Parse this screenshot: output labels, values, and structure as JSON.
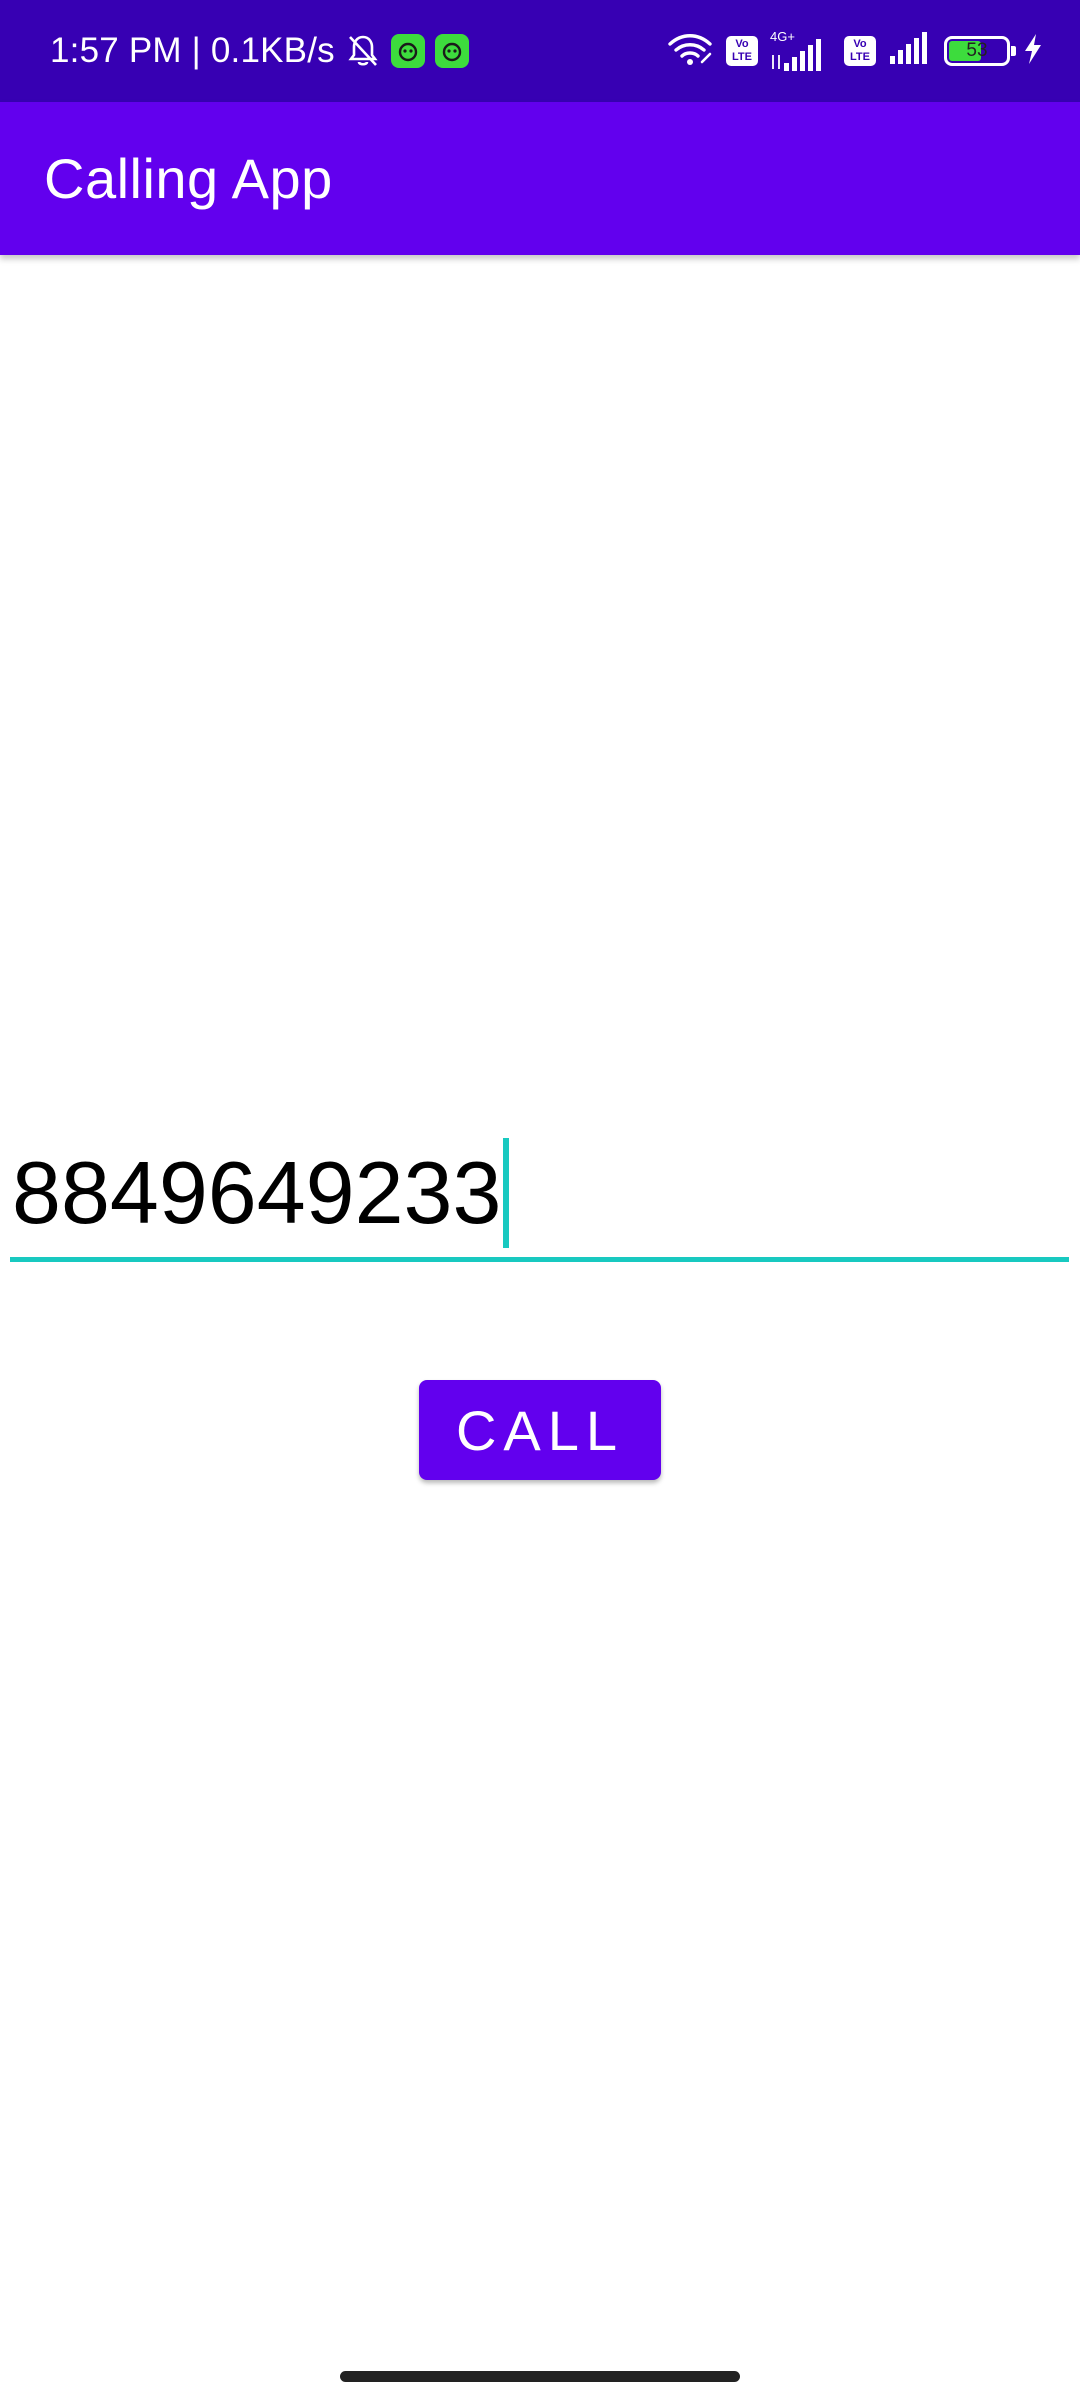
{
  "status_bar": {
    "time_text": "1:57 PM | 0.1KB/s",
    "battery_level": "53",
    "network_label": "4G+",
    "volte_label": "Vo LTE",
    "icons": [
      "muted-notifications-icon",
      "app-notification-icon",
      "app-notification-icon",
      "wifi-icon",
      "volte-icon",
      "signal-icon",
      "volte-icon",
      "signal-icon",
      "battery-icon",
      "charging-icon"
    ],
    "background_color": "#3700b3"
  },
  "app_bar": {
    "title": "Calling App",
    "background_color": "#6200ee"
  },
  "phone_input": {
    "value": "8849649233",
    "accent_color": "#18c9c0"
  },
  "call_button": {
    "label": "CALL",
    "background_color": "#6200ee"
  }
}
